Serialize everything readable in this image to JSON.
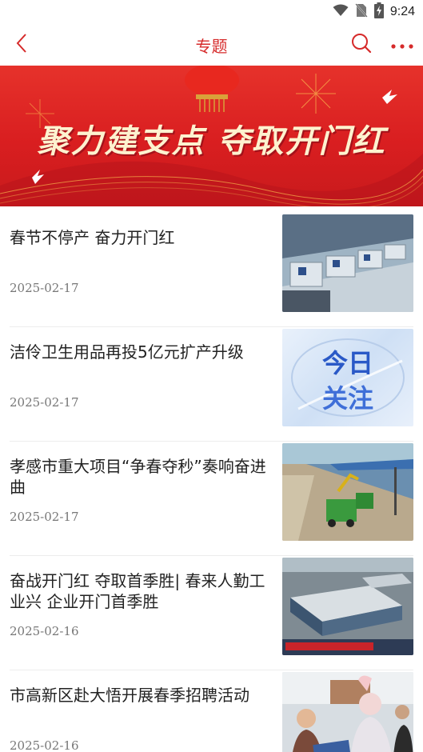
{
  "status_bar": {
    "time": "9:24",
    "icons": [
      "wifi-icon",
      "no-sim-icon",
      "battery-charging-icon"
    ]
  },
  "header": {
    "title": "专题",
    "back_icon": "chevron-left-icon",
    "search_icon": "search-icon",
    "more_icon": "more-dots-icon",
    "accent_color": "#d62a2a"
  },
  "banner": {
    "text": "聚力建支点  夺取开门红",
    "colors": {
      "background": "#d91e20",
      "text": "#fdf2cf"
    }
  },
  "articles": [
    {
      "title": "春节不停产  奋力开门红",
      "date": "2025-02-17",
      "thumbnail": "factory-machines-image"
    },
    {
      "title": "洁伶卫生用品再投5亿元扩产升级",
      "date": "2025-02-17",
      "thumbnail": "jinri-guanzhu-graphic",
      "thumbnail_text": [
        "今日",
        "关注"
      ]
    },
    {
      "title": "孝感市重大项目“争春夺秒”奏响奋进曲",
      "date": "2025-02-17",
      "thumbnail": "construction-site-image"
    },
    {
      "title": "奋战开门红  夺取首季胜|  春来人勤工业兴  企业开门首季胜",
      "date": "2025-02-16",
      "thumbnail": "factory-aerial-image"
    },
    {
      "title": "市高新区赴大悟开展春季招聘活动",
      "date": "2025-02-16",
      "thumbnail": "job-fair-crowd-image"
    }
  ]
}
